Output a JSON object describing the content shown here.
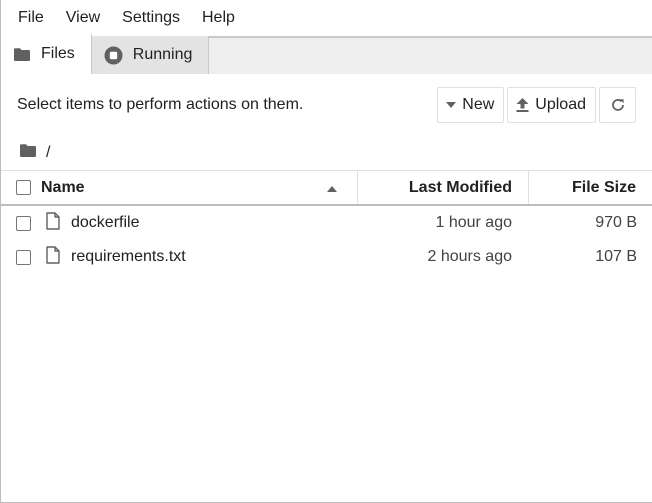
{
  "menubar": {
    "items": [
      "File",
      "View",
      "Settings",
      "Help"
    ]
  },
  "tabs": [
    {
      "label": "Files",
      "icon": "folder-icon",
      "active": true
    },
    {
      "label": "Running",
      "icon": "stop-circle-icon",
      "active": false
    }
  ],
  "toolbar": {
    "message": "Select items to perform actions on them.",
    "new_label": "New",
    "upload_label": "Upload",
    "refresh_icon": "refresh-icon"
  },
  "breadcrumb": {
    "path": "/"
  },
  "listing": {
    "columns": {
      "name": "Name",
      "modified": "Last Modified",
      "size": "File Size"
    },
    "sort": {
      "column": "name",
      "direction": "ascending"
    },
    "files": [
      {
        "name": "dockerfile",
        "modified": "1 hour ago",
        "size": "970 B"
      },
      {
        "name": "requirements.txt",
        "modified": "2 hours ago",
        "size": "107 B"
      }
    ]
  }
}
